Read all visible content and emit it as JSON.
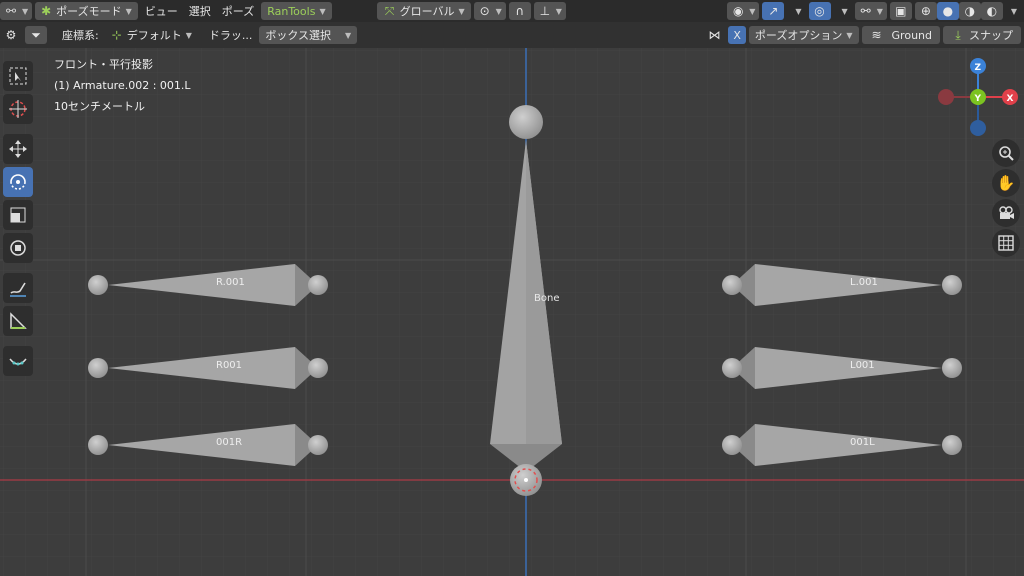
{
  "topbar": {
    "mode_label": "ポーズモード",
    "menus": [
      "ビュー",
      "選択",
      "ポーズ"
    ],
    "addon_label": "RanTools",
    "transform_orientation": "グローバル"
  },
  "header2": {
    "coord_label": "座標系:",
    "coord_value": "デフォルト",
    "drag_label": "ドラッ...",
    "select_mode": "ボックス選択",
    "x_mirror": "X",
    "pose_options": "ポーズオプション",
    "ground_label": "Ground",
    "snap_label": "スナップ"
  },
  "viewport": {
    "view_name": "フロント・平行投影",
    "object_info": "(1) Armature.002 : 001.L",
    "scale_info": "10センチメートル"
  },
  "gizmo": {
    "z": "Z",
    "y": "Y",
    "x": "X"
  },
  "bones": {
    "center": "Bone",
    "r1": "R.001",
    "r2": "R001",
    "r3": "001R",
    "l1": "L.001",
    "l2": "L001",
    "l3": "001L"
  },
  "colors": {
    "accent": "#4772b3",
    "x_axis": "#e0404a",
    "y_axis": "#7cc321",
    "z_axis": "#3b82d8"
  }
}
